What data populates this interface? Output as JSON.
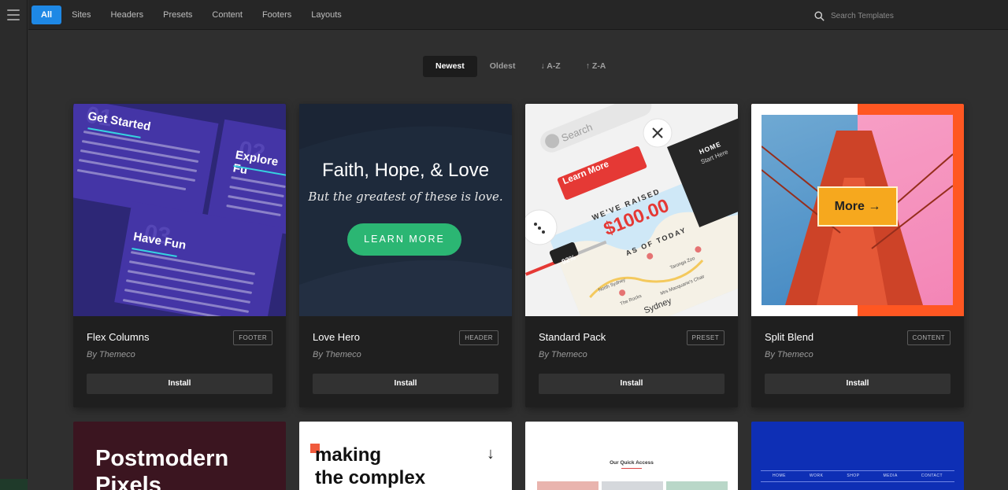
{
  "topbar": {
    "tabs": [
      {
        "label": "All",
        "active": true
      },
      {
        "label": "Sites"
      },
      {
        "label": "Headers"
      },
      {
        "label": "Presets"
      },
      {
        "label": "Content"
      },
      {
        "label": "Footers"
      },
      {
        "label": "Layouts"
      }
    ],
    "search": {
      "placeholder": "Search Templates"
    }
  },
  "sort": [
    {
      "label": "Newest",
      "active": true
    },
    {
      "label": "Oldest"
    },
    {
      "label": "↓ A-Z"
    },
    {
      "label": "↑ Z-A"
    }
  ],
  "install_label": "Install",
  "cards": [
    {
      "name": "Flex Columns",
      "author": "By Themeco",
      "badge": "FOOTER",
      "preview": {
        "h1": "Get Started",
        "h2": "Explore Fu",
        "h3": "Have Fun",
        "n1": "01",
        "n2": "02",
        "n3": "03"
      }
    },
    {
      "name": "Love Hero",
      "author": "By Themeco",
      "badge": "HEADER",
      "preview": {
        "title": "Faith, Hope, & Love",
        "subtitle": "But the greatest of these is love.",
        "button": "LEARN MORE"
      }
    },
    {
      "name": "Standard Pack",
      "author": "By Themeco",
      "badge": "PRESET",
      "preview": {
        "search": "Search",
        "learn": "Learn More",
        "raised": "WE'VE RAISED",
        "amount": "$100.00",
        "asof": "AS OF TODAY",
        "percent": "92%",
        "home": "HOME",
        "start": "Start Here",
        "city": "Sydney",
        "map1": "North Sydney",
        "map2": "Taronga Zoo",
        "map3": "The Rocks",
        "map4": "Mrs Macquarie's Chair"
      }
    },
    {
      "name": "Split Blend",
      "author": "By Themeco",
      "badge": "CONTENT",
      "preview": {
        "button": "More →"
      }
    }
  ],
  "lower": [
    {
      "title_line1": "Postmodern",
      "title_line2": "Pixels"
    },
    {
      "title_line1": "making",
      "title_line2": "the complex",
      "arrow": "↓"
    },
    {
      "title": "Our Quick Access"
    },
    {
      "nav": [
        "HOME",
        "WORK",
        "SHOP",
        "MEDIA",
        "CONTACT"
      ]
    }
  ],
  "colors": {
    "accent": "#1e88e5",
    "install_bg": "#323232",
    "card_bg": "#1f1f1f"
  }
}
